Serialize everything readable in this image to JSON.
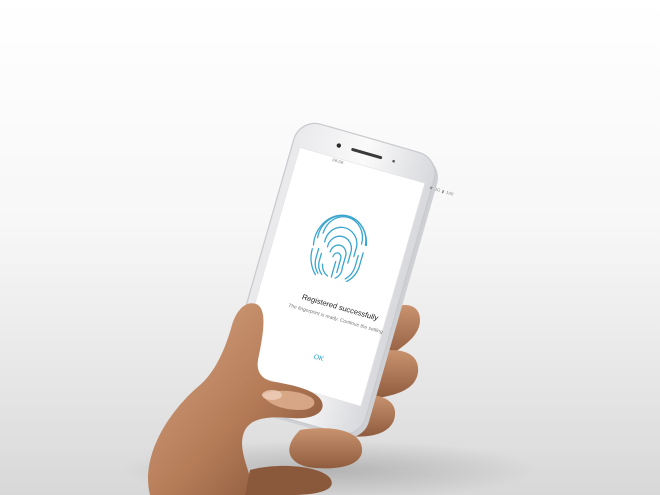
{
  "status_bar": {
    "time": "08:08",
    "network": "3G",
    "battery": "100"
  },
  "dialog": {
    "title": "Registered successfully",
    "message": "The fingerprint is ready. Continue the setting",
    "ok_label": "OK"
  },
  "colors": {
    "accent": "#2aa3c9",
    "fingerprint": "#3aa6cf",
    "phone_frame": "#f4f4f4",
    "skin": "#c08a66"
  },
  "icons": [
    "fingerprint-icon",
    "home-button-icon",
    "camera-icon",
    "speaker-icon"
  ]
}
